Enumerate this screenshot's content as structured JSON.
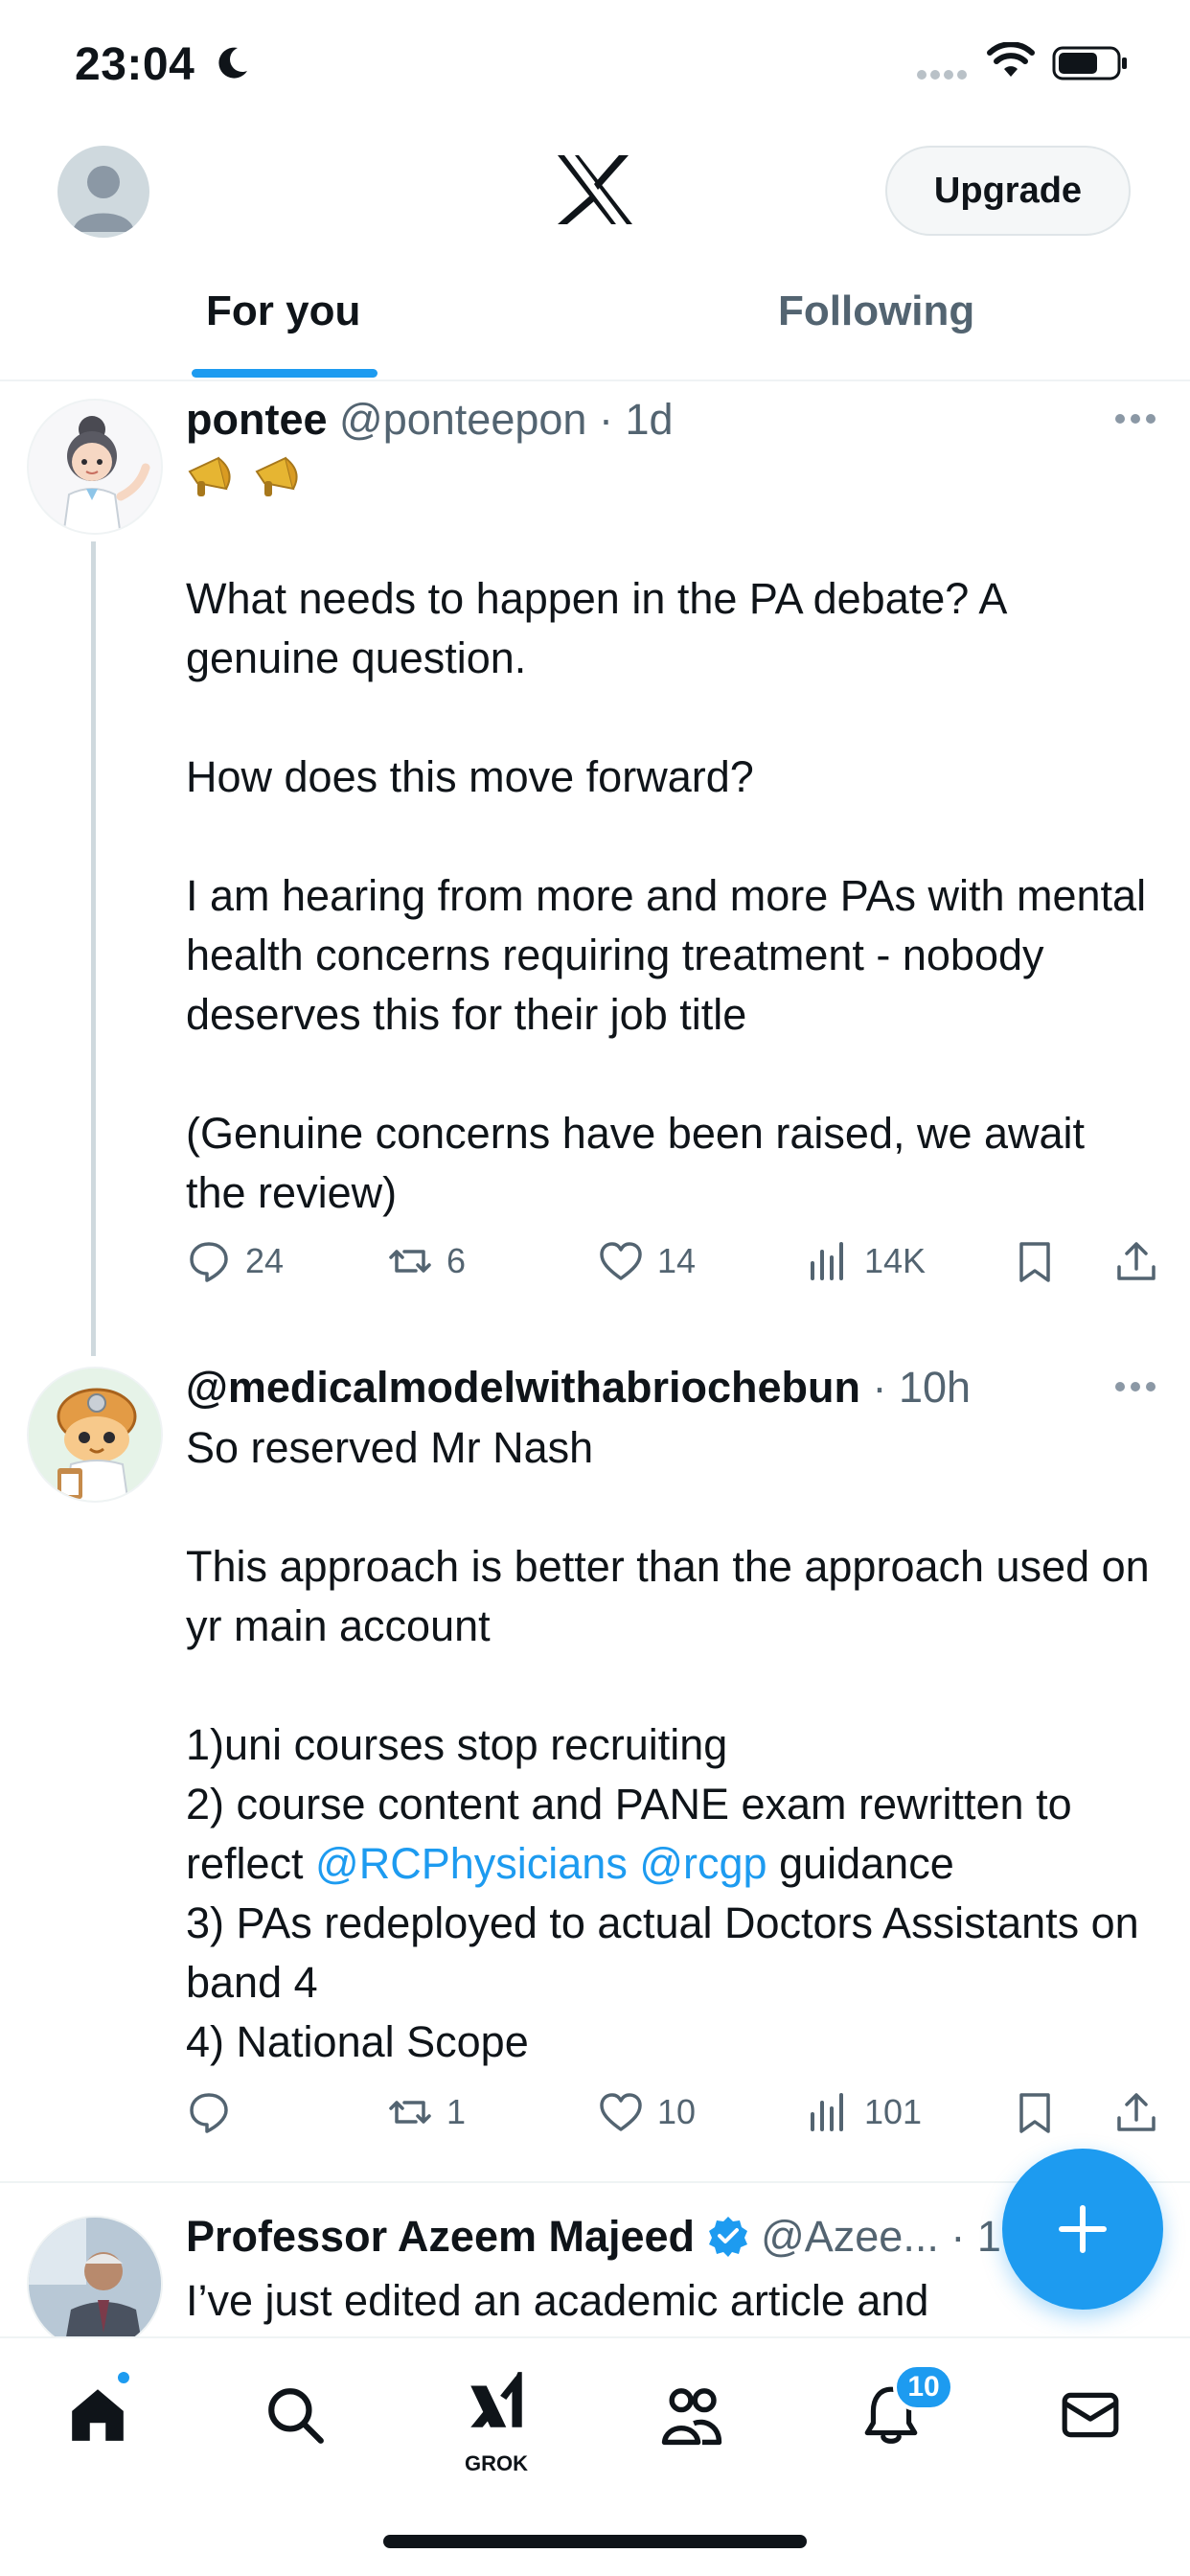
{
  "status_bar": {
    "time": "23:04"
  },
  "header": {
    "upgrade_label": "Upgrade",
    "tabs": [
      {
        "label": "For you",
        "active": true
      },
      {
        "label": "Following",
        "active": false
      }
    ]
  },
  "colors": {
    "accent": "#1d9bf0",
    "text": "#0f1419",
    "secondary": "#536471"
  },
  "tweets": [
    {
      "name": "pontee",
      "handle": "@ponteepon",
      "time": "· 1d",
      "emoji": "📣📣",
      "body": "What needs to happen in the PA debate? A genuine question.\n\nHow does this move forward?\n\nI am hearing from more and more PAs with mental health concerns requiring treatment - nobody deserves this for their job title\n\n(Genuine concerns have been raised, we await the review)",
      "replies": "24",
      "reposts": "6",
      "likes": "14",
      "views": "14K"
    },
    {
      "name": "@medicalmodelwithabriochebun",
      "time": "· 10h",
      "body_part1": "So reserved Mr Nash\n\nThis approach is better than the approach used on yr main account\n\n1)uni courses stop recruiting\n2) course content and PANE exam rewritten to reflect ",
      "mention1": "@RCPhysicians",
      "mention2": "@rcgp",
      "body_part2": " guidance\n3) PAs redeployed to actual Doctors Assistants on band 4\n4) National Scope",
      "reposts": "1",
      "likes": "10",
      "views": "101"
    },
    {
      "name": "Professor Azeem Majeed",
      "handle": "@Azee...",
      "time": "· 1",
      "body": "I’ve just edited an academic article and"
    }
  ],
  "bottom_nav": {
    "items": [
      "home-icon",
      "search-icon",
      "grok-icon",
      "communities-icon",
      "notifications-icon",
      "messages-icon"
    ],
    "grok_label": "GROK",
    "notification_count": "10"
  }
}
